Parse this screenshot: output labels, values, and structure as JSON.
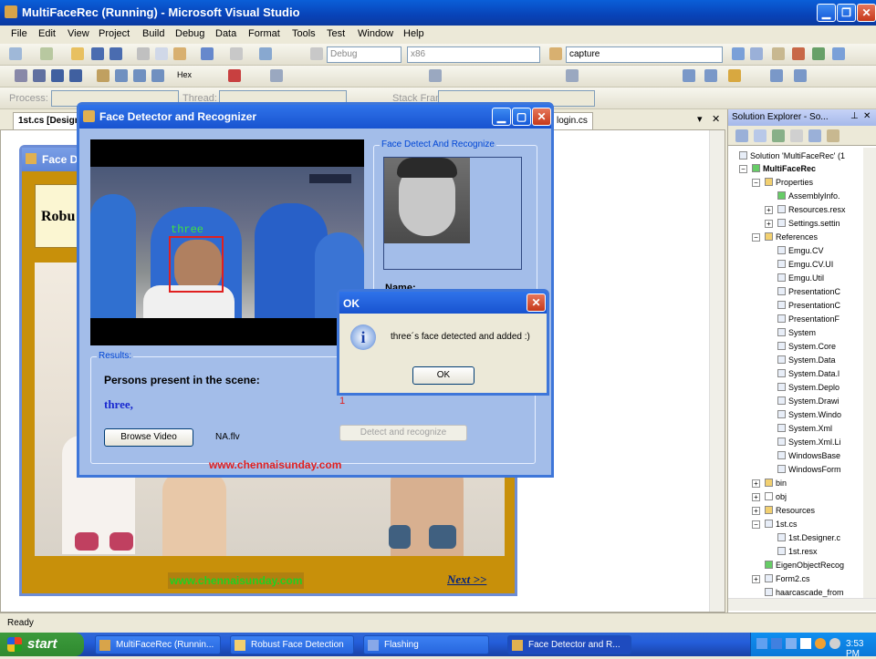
{
  "vs": {
    "title": "MultiFaceRec (Running) - Microsoft Visual Studio",
    "menu": [
      "File",
      "Edit",
      "View",
      "Project",
      "Build",
      "Debug",
      "Data",
      "Format",
      "Tools",
      "Test",
      "Window",
      "Help"
    ],
    "config_combo": "Debug",
    "platform_combo": "x86",
    "find_combo": "capture",
    "process_label": "Process:",
    "thread_label": "Thread:",
    "stack_label": "Stack Frame:",
    "tab_active": "1st.cs [Design]",
    "tab_other": "login.cs",
    "status": "Ready"
  },
  "solution_explorer": {
    "title": "Solution Explorer - So...",
    "items": [
      "Solution 'MultiFaceRec' (1",
      "MultiFaceRec",
      "Properties",
      "AssemblyInfo.",
      "Resources.resx",
      "Settings.settin",
      "References",
      "Emgu.CV",
      "Emgu.CV.UI",
      "Emgu.Util",
      "PresentationC",
      "PresentationC",
      "PresentationF",
      "System",
      "System.Core",
      "System.Data",
      "System.Data.l",
      "System.Deplo",
      "System.Drawi",
      "System.Windo",
      "System.Xml",
      "System.Xml.Li",
      "WindowsBase",
      "WindowsForm",
      "bin",
      "obj",
      "Resources",
      "1st.cs",
      "1st.Designer.c",
      "1st.resx",
      "EigenObjectRecog",
      "Form2.cs",
      "haarcascade_from"
    ]
  },
  "bg_form": {
    "title": "Face D",
    "heading": "Robu",
    "link": "www.chennaisunday.com",
    "next": "Next >>"
  },
  "face_form": {
    "title": "Face Detector and Recognizer",
    "video_label": "three",
    "group_detect": "Face Detect And Recognize",
    "name_label": "Name:",
    "results_label": "Results:",
    "persons_label": "Persons present in the scene:",
    "persons_value": "three,",
    "count": "1",
    "browse_button": "Browse Video",
    "na_text": "NA.flv",
    "detect_button": "Detect and recognize",
    "footer_link": "www.chennaisunday.com"
  },
  "dialog": {
    "title": "OK",
    "message": "three´s face detected and added :)",
    "ok_button": "OK"
  },
  "taskbar": {
    "start": "start",
    "tasks": [
      "MultiFaceRec (Runnin...",
      "Robust Face Detection",
      "Flashing",
      "Face Detector and R..."
    ],
    "clock": "3:53 PM"
  }
}
